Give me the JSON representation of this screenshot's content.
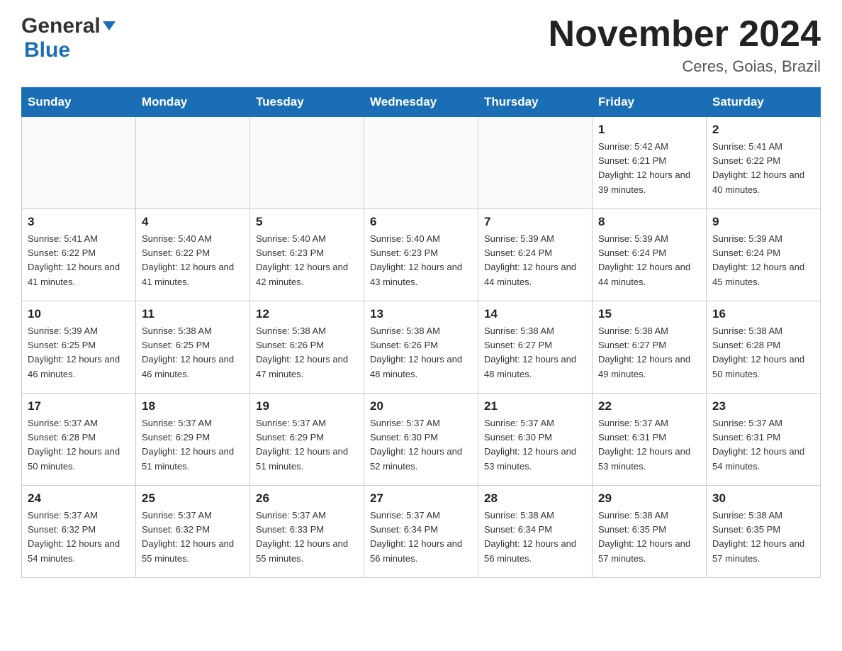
{
  "header": {
    "logo_general": "General",
    "logo_blue": "Blue",
    "month_title": "November 2024",
    "location": "Ceres, Goias, Brazil"
  },
  "calendar": {
    "days_of_week": [
      "Sunday",
      "Monday",
      "Tuesday",
      "Wednesday",
      "Thursday",
      "Friday",
      "Saturday"
    ],
    "weeks": [
      [
        {
          "day": "",
          "info": ""
        },
        {
          "day": "",
          "info": ""
        },
        {
          "day": "",
          "info": ""
        },
        {
          "day": "",
          "info": ""
        },
        {
          "day": "",
          "info": ""
        },
        {
          "day": "1",
          "info": "Sunrise: 5:42 AM\nSunset: 6:21 PM\nDaylight: 12 hours and 39 minutes."
        },
        {
          "day": "2",
          "info": "Sunrise: 5:41 AM\nSunset: 6:22 PM\nDaylight: 12 hours and 40 minutes."
        }
      ],
      [
        {
          "day": "3",
          "info": "Sunrise: 5:41 AM\nSunset: 6:22 PM\nDaylight: 12 hours and 41 minutes."
        },
        {
          "day": "4",
          "info": "Sunrise: 5:40 AM\nSunset: 6:22 PM\nDaylight: 12 hours and 41 minutes."
        },
        {
          "day": "5",
          "info": "Sunrise: 5:40 AM\nSunset: 6:23 PM\nDaylight: 12 hours and 42 minutes."
        },
        {
          "day": "6",
          "info": "Sunrise: 5:40 AM\nSunset: 6:23 PM\nDaylight: 12 hours and 43 minutes."
        },
        {
          "day": "7",
          "info": "Sunrise: 5:39 AM\nSunset: 6:24 PM\nDaylight: 12 hours and 44 minutes."
        },
        {
          "day": "8",
          "info": "Sunrise: 5:39 AM\nSunset: 6:24 PM\nDaylight: 12 hours and 44 minutes."
        },
        {
          "day": "9",
          "info": "Sunrise: 5:39 AM\nSunset: 6:24 PM\nDaylight: 12 hours and 45 minutes."
        }
      ],
      [
        {
          "day": "10",
          "info": "Sunrise: 5:39 AM\nSunset: 6:25 PM\nDaylight: 12 hours and 46 minutes."
        },
        {
          "day": "11",
          "info": "Sunrise: 5:38 AM\nSunset: 6:25 PM\nDaylight: 12 hours and 46 minutes."
        },
        {
          "day": "12",
          "info": "Sunrise: 5:38 AM\nSunset: 6:26 PM\nDaylight: 12 hours and 47 minutes."
        },
        {
          "day": "13",
          "info": "Sunrise: 5:38 AM\nSunset: 6:26 PM\nDaylight: 12 hours and 48 minutes."
        },
        {
          "day": "14",
          "info": "Sunrise: 5:38 AM\nSunset: 6:27 PM\nDaylight: 12 hours and 48 minutes."
        },
        {
          "day": "15",
          "info": "Sunrise: 5:38 AM\nSunset: 6:27 PM\nDaylight: 12 hours and 49 minutes."
        },
        {
          "day": "16",
          "info": "Sunrise: 5:38 AM\nSunset: 6:28 PM\nDaylight: 12 hours and 50 minutes."
        }
      ],
      [
        {
          "day": "17",
          "info": "Sunrise: 5:37 AM\nSunset: 6:28 PM\nDaylight: 12 hours and 50 minutes."
        },
        {
          "day": "18",
          "info": "Sunrise: 5:37 AM\nSunset: 6:29 PM\nDaylight: 12 hours and 51 minutes."
        },
        {
          "day": "19",
          "info": "Sunrise: 5:37 AM\nSunset: 6:29 PM\nDaylight: 12 hours and 51 minutes."
        },
        {
          "day": "20",
          "info": "Sunrise: 5:37 AM\nSunset: 6:30 PM\nDaylight: 12 hours and 52 minutes."
        },
        {
          "day": "21",
          "info": "Sunrise: 5:37 AM\nSunset: 6:30 PM\nDaylight: 12 hours and 53 minutes."
        },
        {
          "day": "22",
          "info": "Sunrise: 5:37 AM\nSunset: 6:31 PM\nDaylight: 12 hours and 53 minutes."
        },
        {
          "day": "23",
          "info": "Sunrise: 5:37 AM\nSunset: 6:31 PM\nDaylight: 12 hours and 54 minutes."
        }
      ],
      [
        {
          "day": "24",
          "info": "Sunrise: 5:37 AM\nSunset: 6:32 PM\nDaylight: 12 hours and 54 minutes."
        },
        {
          "day": "25",
          "info": "Sunrise: 5:37 AM\nSunset: 6:32 PM\nDaylight: 12 hours and 55 minutes."
        },
        {
          "day": "26",
          "info": "Sunrise: 5:37 AM\nSunset: 6:33 PM\nDaylight: 12 hours and 55 minutes."
        },
        {
          "day": "27",
          "info": "Sunrise: 5:37 AM\nSunset: 6:34 PM\nDaylight: 12 hours and 56 minutes."
        },
        {
          "day": "28",
          "info": "Sunrise: 5:38 AM\nSunset: 6:34 PM\nDaylight: 12 hours and 56 minutes."
        },
        {
          "day": "29",
          "info": "Sunrise: 5:38 AM\nSunset: 6:35 PM\nDaylight: 12 hours and 57 minutes."
        },
        {
          "day": "30",
          "info": "Sunrise: 5:38 AM\nSunset: 6:35 PM\nDaylight: 12 hours and 57 minutes."
        }
      ]
    ]
  }
}
